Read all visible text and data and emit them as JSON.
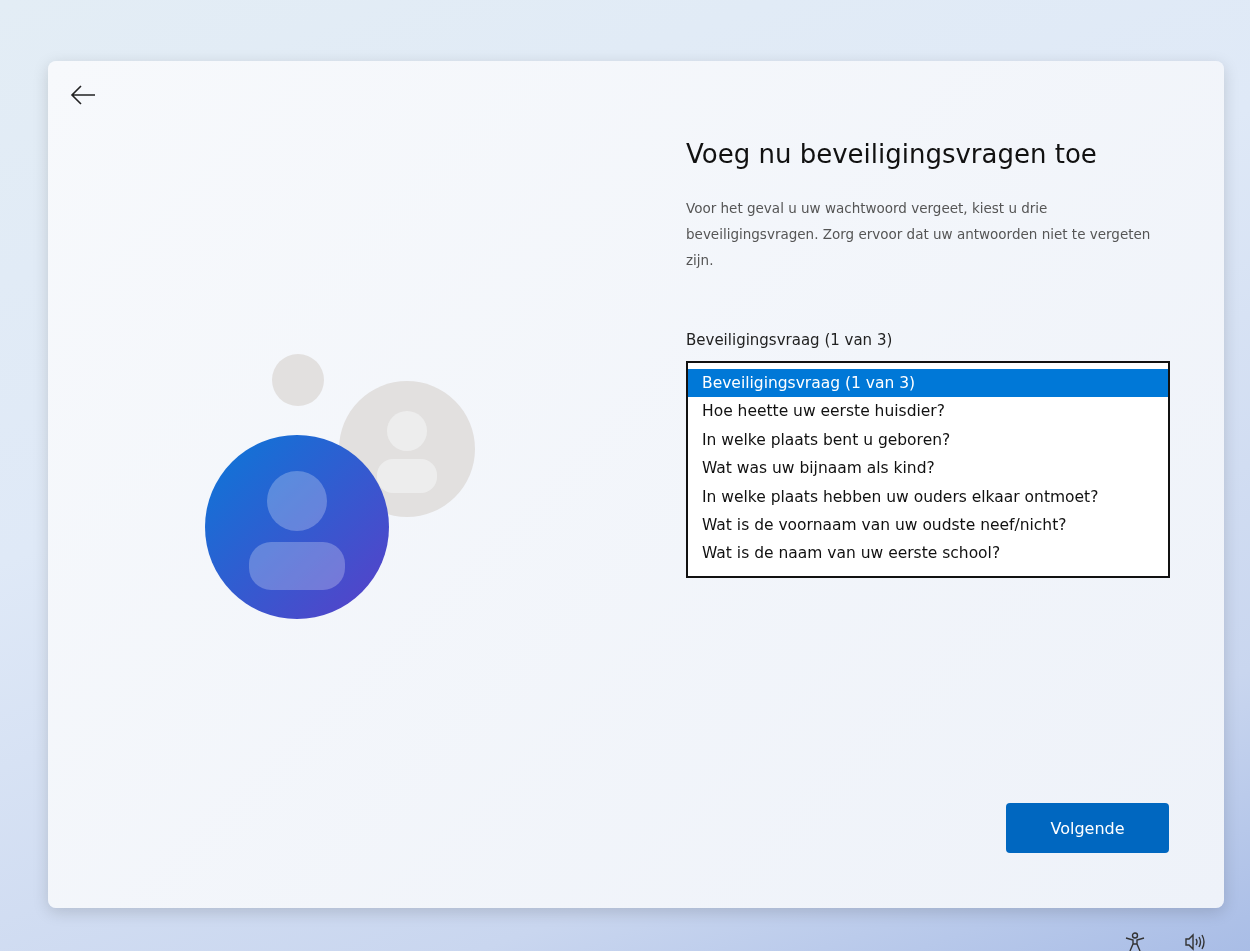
{
  "page": {
    "title": "Voeg nu beveiligingsvragen toe",
    "description": "Voor het geval u uw wachtwoord vergeet, kiest u drie beveiligingsvragen. Zorg ervoor dat uw antwoorden niet te vergeten zijn."
  },
  "question_field": {
    "label": "Beveiligingsvraag (1 van 3)",
    "options": [
      {
        "label": "Beveiligingsvraag (1 van 3)",
        "selected": true
      },
      {
        "label": "Hoe heette uw eerste huisdier?",
        "selected": false
      },
      {
        "label": "In welke plaats bent u geboren?",
        "selected": false
      },
      {
        "label": "Wat was uw bijnaam als kind?",
        "selected": false
      },
      {
        "label": "In welke plaats hebben uw ouders elkaar ontmoet?",
        "selected": false
      },
      {
        "label": "Wat is de voornaam van uw oudste neef/nicht?",
        "selected": false
      },
      {
        "label": "Wat is de naam van uw eerste school?",
        "selected": false
      }
    ]
  },
  "next_button": {
    "label": "Volgende"
  }
}
